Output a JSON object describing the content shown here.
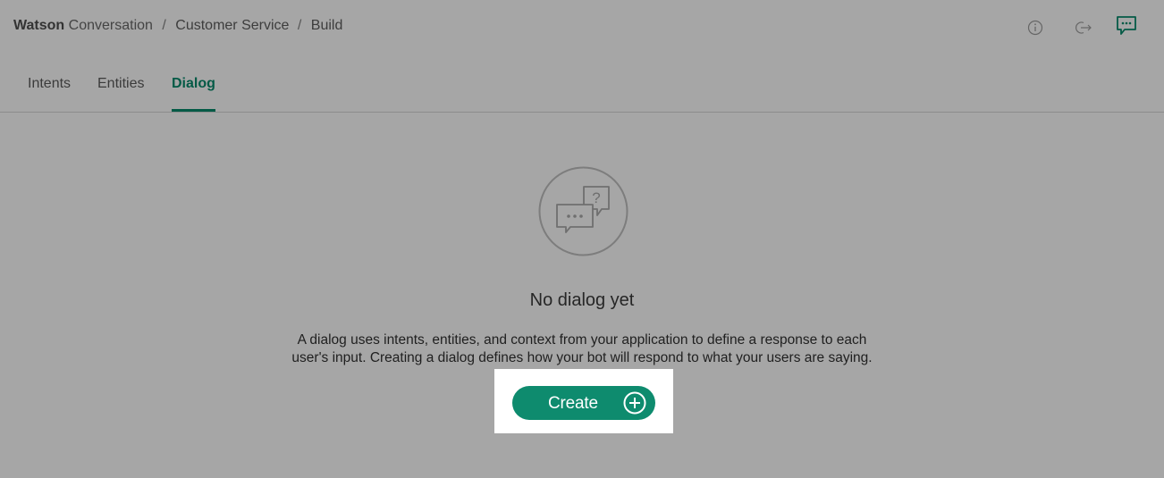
{
  "breadcrumb": {
    "brand": "Watson",
    "product": "Conversation",
    "separator": "/",
    "workspace": "Customer Service",
    "page": "Build"
  },
  "top_icons": [
    "info-icon",
    "logout-icon",
    "chat-icon"
  ],
  "tabs": [
    {
      "label": "Intents",
      "active": false
    },
    {
      "label": "Entities",
      "active": false
    },
    {
      "label": "Dialog",
      "active": true
    }
  ],
  "empty_state": {
    "illustration": "chat-bubbles-icon",
    "heading": "No dialog yet",
    "description_line1": "A dialog uses intents, entities, and context from your application to define a response to each",
    "description_line2": "user's input. Creating a dialog defines how your bot will respond to what your users are saying.",
    "create_label": "Create",
    "create_icon": "plus-circle-icon"
  },
  "colors": {
    "overlay_background": "#a6a6a6",
    "accent": "#045a46",
    "button": "#0e8b6e",
    "highlight": "#ffffff"
  }
}
